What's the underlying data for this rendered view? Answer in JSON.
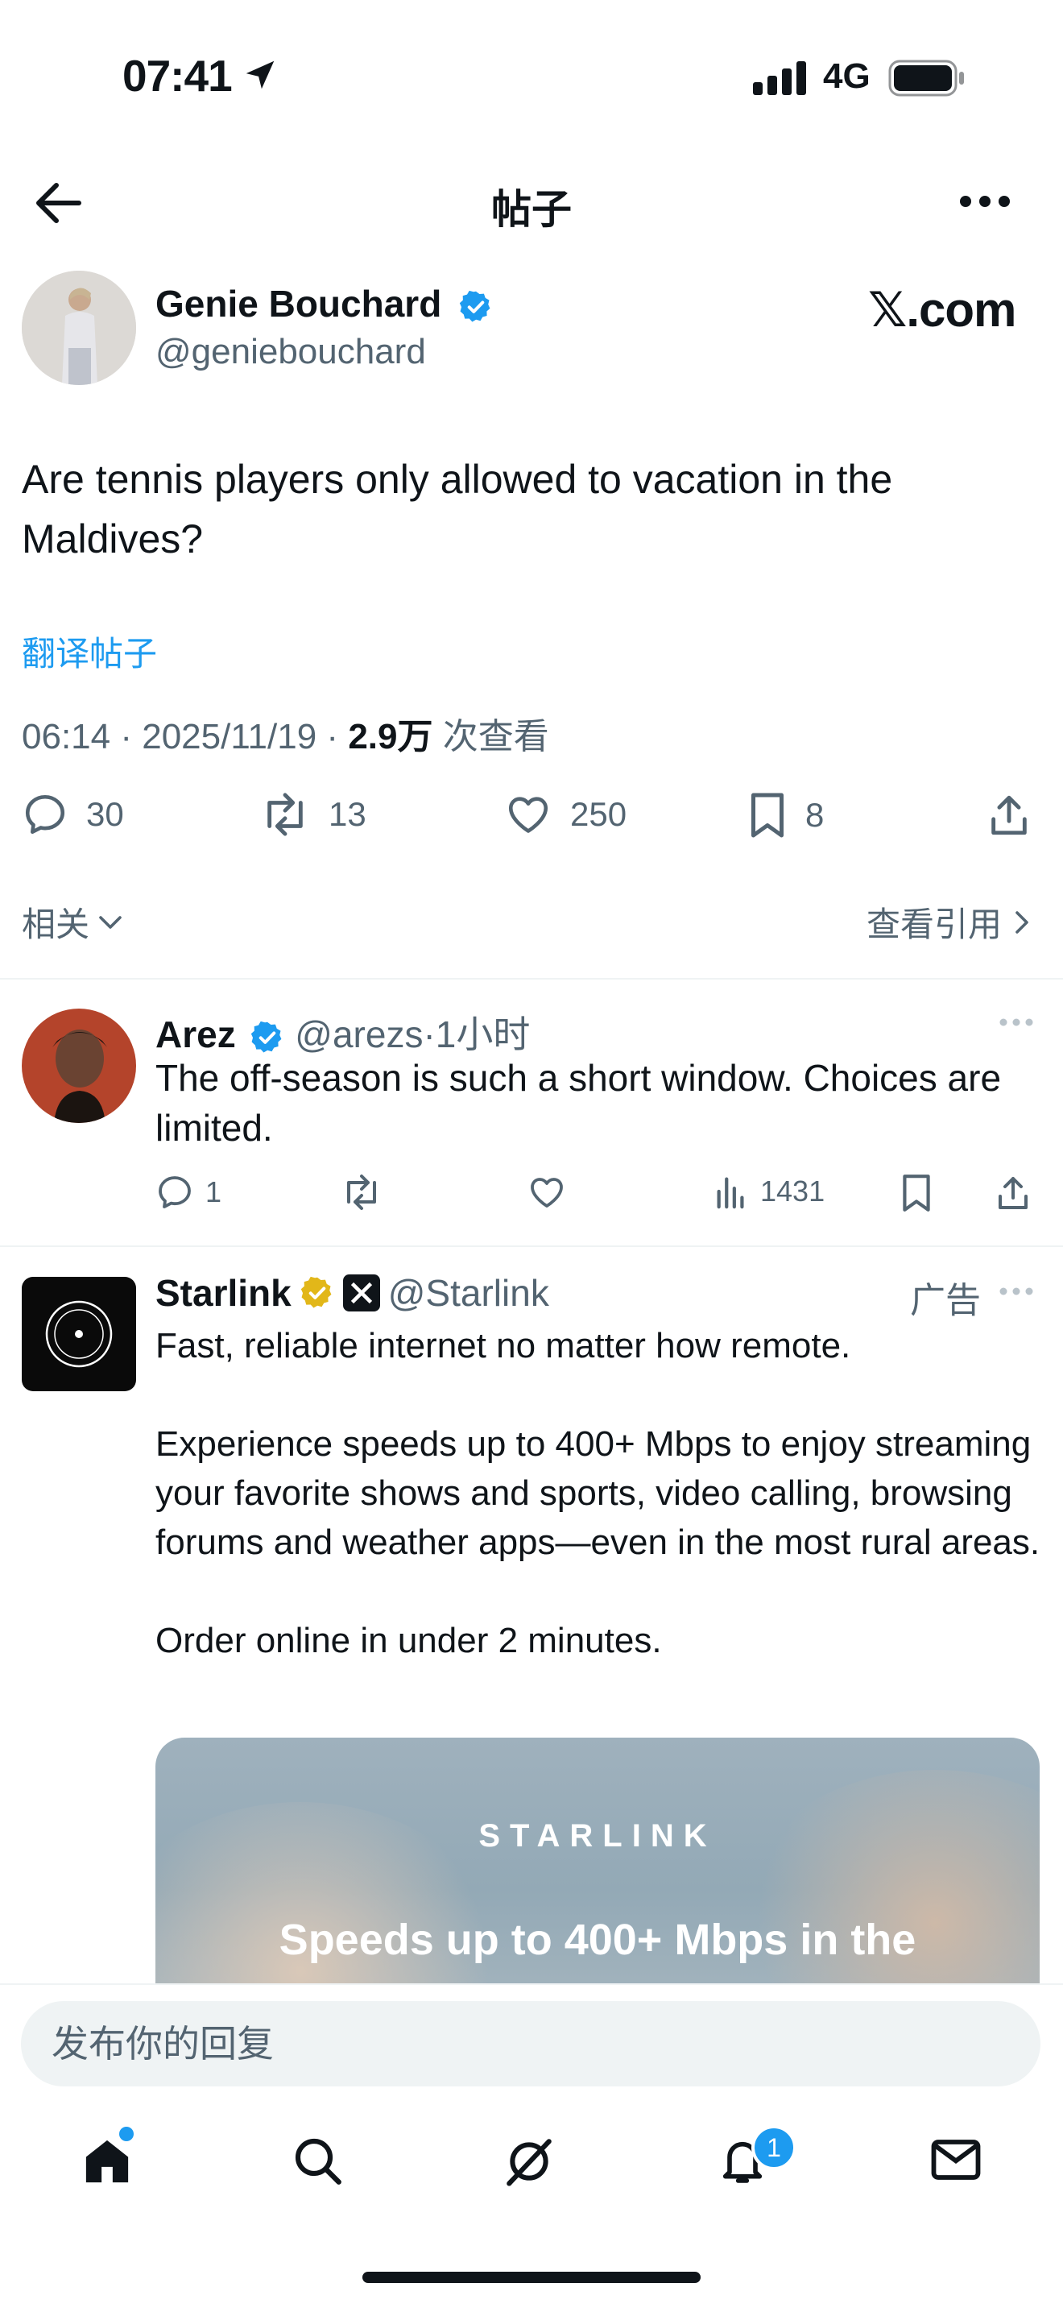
{
  "status_bar": {
    "time": "07:41",
    "network": "4G"
  },
  "header": {
    "title": "帖子"
  },
  "main_tweet": {
    "author_name": "Genie Bouchard",
    "author_handle": "@geniebouchard",
    "watermark": "𝕏.com",
    "text": "Are tennis players only allowed to vacation in the Maldives?",
    "translate_label": "翻译帖子",
    "time": "06:14",
    "date": "2025/11/19",
    "views_count": "2.9万",
    "views_label": "次查看",
    "replies": "30",
    "reposts": "13",
    "likes": "250",
    "bookmarks": "8",
    "related_label": "相关",
    "quotes_label": "查看引用"
  },
  "reply": {
    "author_name": "Arez",
    "author_handle": "@arezs",
    "age": "1小时",
    "text": "The off-season is such a short window. Choices are limited.",
    "replies": "1",
    "views": "1431"
  },
  "ad": {
    "author_name": "Starlink",
    "author_handle": "@Starlink",
    "ad_label": "广告",
    "text": "Fast, reliable internet no matter how remote.\n\nExperience speeds up to 400+ Mbps to enjoy streaming your favorite shows and sports, video calling, browsing forums and weather apps—even in the most rural areas.\n\nOrder online in under 2 minutes.",
    "card_brand": "STARLINK",
    "card_headline": "Speeds up to 400+ Mbps in the"
  },
  "composer": {
    "placeholder": "发布你的回复"
  },
  "tab_bar": {
    "notifications_badge": "1"
  },
  "colors": {
    "accent": "#1d9bf0",
    "muted": "#536471",
    "verified_gold": "#e2b719"
  }
}
